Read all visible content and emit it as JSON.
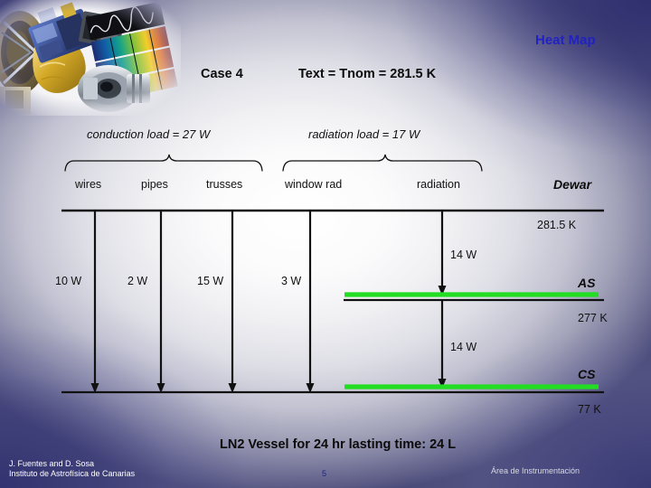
{
  "slide": {
    "heat_map_title": "Heat Map",
    "case_label": "Case 4",
    "text_temp": "Text = Tnom = 281.5 K",
    "bottom_title": "LN2 Vessel for 24 hr lasting time: 24 L"
  },
  "loads": {
    "conduction": "conduction load = 27 W",
    "radiation": "radiation load = 17 W"
  },
  "nodes": [
    {
      "label": "wires",
      "watt": "10 W"
    },
    {
      "label": "pipes",
      "watt": "2 W"
    },
    {
      "label": "trusses",
      "watt": "15 W"
    },
    {
      "label": "window rad",
      "watt": "3 W"
    },
    {
      "label": "radiation",
      "watt": ""
    }
  ],
  "stages": {
    "dewar_label": "Dewar",
    "dewar_temp": "281.5 K",
    "as_label": "AS",
    "as_temp": "277 K",
    "as_watt": "14 W",
    "cs_label": "CS",
    "cs_temp": "77 K",
    "cs_watt": "14 W"
  },
  "footer": {
    "author_line1": "J. Fuentes and D. Sosa",
    "author_line2": "Instituto de Astrofísica de Canarias",
    "page_number": "5",
    "department": "Área de Instrumentación"
  },
  "colors": {
    "accent_green": "#22dd22",
    "title_blue": "#2121c4",
    "background_dark": "#3b3b6e"
  }
}
